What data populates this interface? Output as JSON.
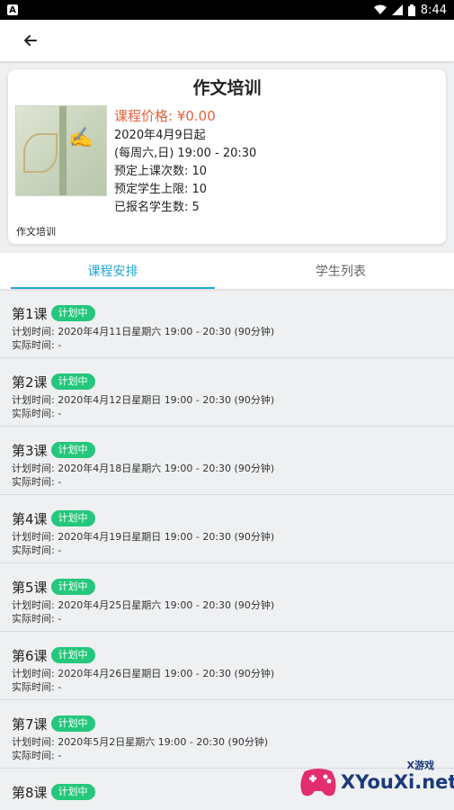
{
  "statusbar": {
    "app_glyph": "A",
    "time": "8:44",
    "icons": [
      "wifi-icon",
      "signal-icon",
      "battery-icon"
    ]
  },
  "appbar": {
    "back_icon": "arrow-left-icon"
  },
  "course": {
    "title": "作文培训",
    "price": "课程价格: ¥0.00",
    "start": "2020年4月9日起",
    "schedule": "(每周六,日) 19:00 - 20:30",
    "planned_sessions": "预定上课次数: 10",
    "student_limit": "预定学生上限: 10",
    "enrolled": "已报名学生数: 5",
    "subtitle": "作文培训"
  },
  "tabs": [
    {
      "label": "课程安排",
      "active": true
    },
    {
      "label": "学生列表",
      "active": false
    }
  ],
  "lessons": [
    {
      "title": "第1课",
      "status": "计划中",
      "planned": "计划时间: 2020年4月11日星期六 19:00 - 20:30 (90分钟)",
      "actual": "实际时间: -"
    },
    {
      "title": "第2课",
      "status": "计划中",
      "planned": "计划时间: 2020年4月12日星期日 19:00 - 20:30 (90分钟)",
      "actual": "实际时间: -"
    },
    {
      "title": "第3课",
      "status": "计划中",
      "planned": "计划时间: 2020年4月18日星期六 19:00 - 20:30 (90分钟)",
      "actual": "实际时间: -"
    },
    {
      "title": "第4课",
      "status": "计划中",
      "planned": "计划时间: 2020年4月19日星期日 19:00 - 20:30 (90分钟)",
      "actual": "实际时间: -"
    },
    {
      "title": "第5课",
      "status": "计划中",
      "planned": "计划时间: 2020年4月25日星期六 19:00 - 20:30 (90分钟)",
      "actual": "实际时间: -"
    },
    {
      "title": "第6课",
      "status": "计划中",
      "planned": "计划时间: 2020年4月26日星期日 19:00 - 20:30 (90分钟)",
      "actual": "实际时间: -"
    },
    {
      "title": "第7课",
      "status": "计划中",
      "planned": "计划时间: 2020年5月2日星期六 19:00 - 20:30 (90分钟)",
      "actual": "实际时间: -"
    },
    {
      "title": "第8课",
      "status": "计划中",
      "planned": "",
      "actual": ""
    }
  ],
  "watermark": {
    "top": "X游戏",
    "text": "XYouXi.net"
  },
  "colors": {
    "accent": "#27a7d6",
    "price": "#e6603d",
    "badge": "#24c77b"
  }
}
